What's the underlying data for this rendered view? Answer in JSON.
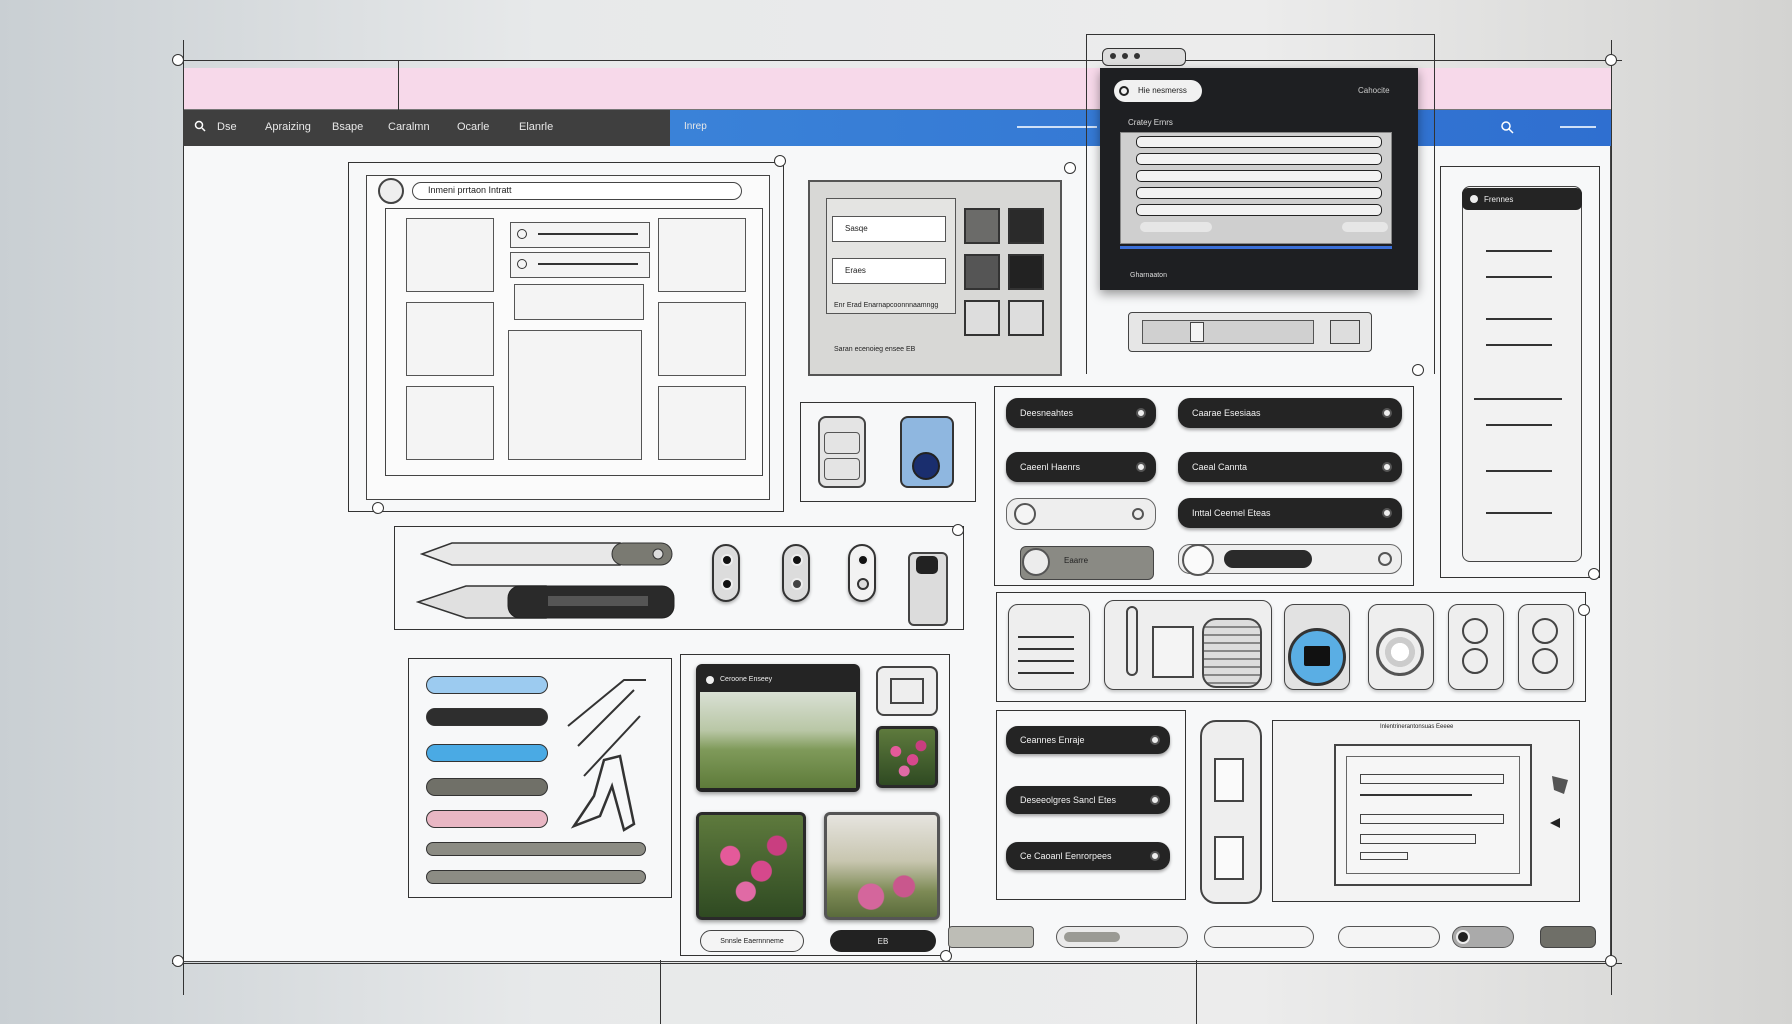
{
  "navbar": {
    "items": [
      "Dse",
      "Apraizing",
      "Bsape",
      "Caralmn",
      "Ocarle",
      "Elanrle"
    ],
    "blue_label": "Inrep"
  },
  "header_panel": {
    "title": "Inmeni prrtaon Intratt"
  },
  "form_panel": {
    "field1": "Sasqe",
    "field2": "Eraes",
    "status": "Enr Erad Enarnapcoonnnaamngg",
    "footer": "Saran ecenoieg ensee EB"
  },
  "dialog": {
    "tab": "Hie nesmerss",
    "tab_right": "Cahocite",
    "subtitle": "Cratey Ernrs",
    "footer": "Gharnaaton"
  },
  "sidebar": {
    "title": "Frennes"
  },
  "action_buttons": {
    "left": [
      "Deesneahtes",
      "Caeenl Haenrs"
    ],
    "right": [
      "Caarae Esesiaas",
      "Caeal Cannta",
      "Inttal Ceemel Eteas"
    ],
    "toggle_label": "Eaarre"
  },
  "image_card": {
    "title": "Ceroone Enseey"
  },
  "bottom_buttons": [
    "Ceannes Enraje",
    "Deseeolgres Sancl Etes",
    "Ce Caoanl Eenrorpees"
  ],
  "preview": {
    "title": "Inlentrinerantonsuas Eeeee"
  },
  "footer_buttons": {
    "image_caption": "Snnsle Eaernnneme",
    "dark_button": "EB"
  },
  "colors": {
    "accent_blue": "#3a82d8",
    "pink": "#f7d9ea",
    "dark": "#242424"
  }
}
